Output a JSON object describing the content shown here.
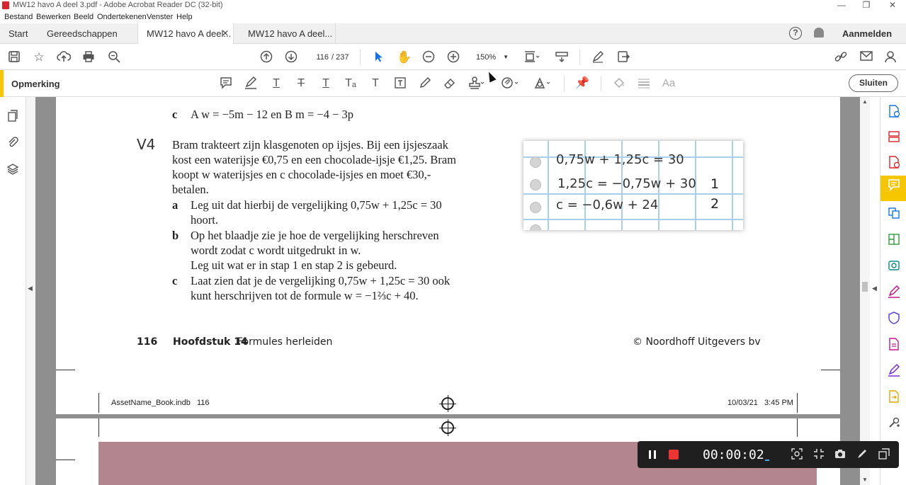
{
  "window": {
    "title": "MW12 havo A deel 3.pdf - Adobe Acrobat Reader DC (32-bit)",
    "minimize": "—",
    "restore": "❐",
    "close": "✕"
  },
  "menu": [
    "Bestand",
    "Bewerken",
    "Beeld",
    "Ondertekenen",
    "Venster",
    "Help"
  ],
  "tabs": {
    "start": "Start",
    "tools": "Gereedschappen",
    "doc1": "MW12 havo A deel...",
    "doc2": "MW12 havo A deel...",
    "close_glyph": "✕"
  },
  "header": {
    "help": "?",
    "signin": "Aanmelden"
  },
  "toolbar": {
    "page_current": "116",
    "page_total": "/  237",
    "zoom": "150%"
  },
  "comment_bar": {
    "label": "Opmerking",
    "close": "Sluiten"
  },
  "document": {
    "line_c_prev_label": "c",
    "line_c_prev_text": "A w = −5m − 12 en B m = −4 − 3p",
    "exercise_number": "V4",
    "intro": [
      "Bram trakteert zijn klasgenoten op ijsjes. Bij een ijsjeszaak",
      "kost een waterijsje €0,75 en een chocolade-ijsje €1,25. Bram",
      "koopt w waterijsjes en c chocolade-ijsjes en moet €30,-",
      "betalen."
    ],
    "a_label": "a",
    "a_lines": [
      "Leg uit dat hierbij de vergelijking 0,75w + 1,25c = 30",
      "hoort."
    ],
    "b_label": "b",
    "b_lines": [
      "Op het blaadje zie je hoe de vergelijking herschreven",
      "wordt zodat c wordt uitgedrukt in w.",
      "Leg uit wat er in stap 1 en stap 2 is gebeurd."
    ],
    "c_label": "c",
    "c_lines": [
      "Laat zien dat je de vergelijking 0,75w + 1,25c = 30 ook",
      "kunt herschrijven tot de formule w = −1⅔c + 40."
    ],
    "notepad": {
      "eq1": "0,75w + 1,25c = 30",
      "eq2": "1,25c = −0,75w + 30",
      "eq3": "c = −0,6w + 24",
      "step1": "1",
      "step2": "2"
    },
    "footer": {
      "page_number": "116",
      "chapter_bold": "Hoofdstuk 14",
      "chapter_title": "Formules herleiden",
      "copyright": "© Noordhoff Uitgevers bv"
    },
    "slug": {
      "file": "AssetName_Book.indb",
      "page": "116",
      "date": "10/03/21",
      "time": "3:45 PM"
    }
  },
  "recorder": {
    "time": "00:00:02"
  },
  "icons": {
    "save": "save-icon",
    "star": "star-icon",
    "upload": "upload-icon",
    "print": "print-icon",
    "search": "zoom-search-icon"
  }
}
